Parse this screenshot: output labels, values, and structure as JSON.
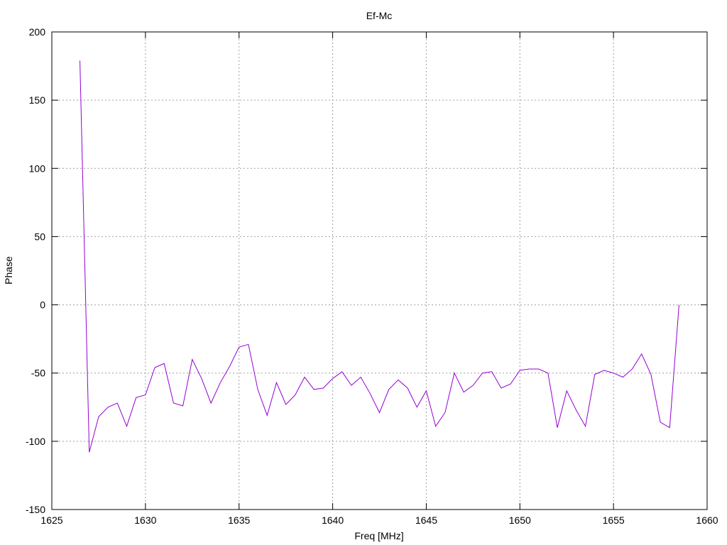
{
  "chart_data": {
    "type": "line",
    "title": "Ef-Mc",
    "xlabel": "Freq [MHz]",
    "ylabel": "Phase",
    "xlim": [
      1625,
      1660
    ],
    "ylim": [
      -150,
      200
    ],
    "x_ticks": [
      1625,
      1630,
      1635,
      1640,
      1645,
      1650,
      1655,
      1660
    ],
    "y_ticks": [
      -150,
      -100,
      -50,
      0,
      50,
      100,
      150,
      200
    ],
    "grid": true,
    "legend": "none",
    "series": [
      {
        "color": "#9400d3",
        "x": [
          1626.5,
          1627.0,
          1627.5,
          1628.0,
          1628.5,
          1629.0,
          1629.5,
          1630.0,
          1630.5,
          1631.0,
          1631.5,
          1632.0,
          1632.5,
          1633.0,
          1633.5,
          1634.0,
          1634.5,
          1635.0,
          1635.5,
          1636.0,
          1636.5,
          1637.0,
          1637.5,
          1638.0,
          1638.5,
          1639.0,
          1639.5,
          1640.0,
          1640.5,
          1641.0,
          1641.5,
          1642.0,
          1642.5,
          1643.0,
          1643.5,
          1644.0,
          1644.5,
          1645.0,
          1645.5,
          1646.0,
          1646.5,
          1647.0,
          1647.5,
          1648.0,
          1648.5,
          1649.0,
          1649.5,
          1650.0,
          1650.5,
          1651.0,
          1651.5,
          1652.0,
          1652.5,
          1653.0,
          1653.5,
          1654.0,
          1654.5,
          1655.0,
          1655.5,
          1656.0,
          1656.5,
          1657.0,
          1657.5,
          1658.0,
          1658.5
        ],
        "y": [
          179,
          -108,
          -82,
          -75,
          -72,
          -89,
          -68,
          -66,
          -46,
          -43,
          -72,
          -74,
          -40,
          -54,
          -72,
          -57,
          -45,
          -31,
          -29,
          -62,
          -81,
          -57,
          -73,
          -66,
          -53,
          -62,
          -61,
          -54,
          -49,
          -59,
          -53,
          -65,
          -79,
          -62,
          -55,
          -61,
          -75,
          -63,
          -89,
          -79,
          -50,
          -64,
          -59,
          -50,
          -49,
          -61,
          -58,
          -48,
          -47,
          -47,
          -50,
          -90,
          -63,
          -77,
          -89,
          -51,
          -48,
          -50,
          -53,
          -47,
          -36,
          -51,
          -86,
          -90,
          0
        ]
      }
    ]
  }
}
